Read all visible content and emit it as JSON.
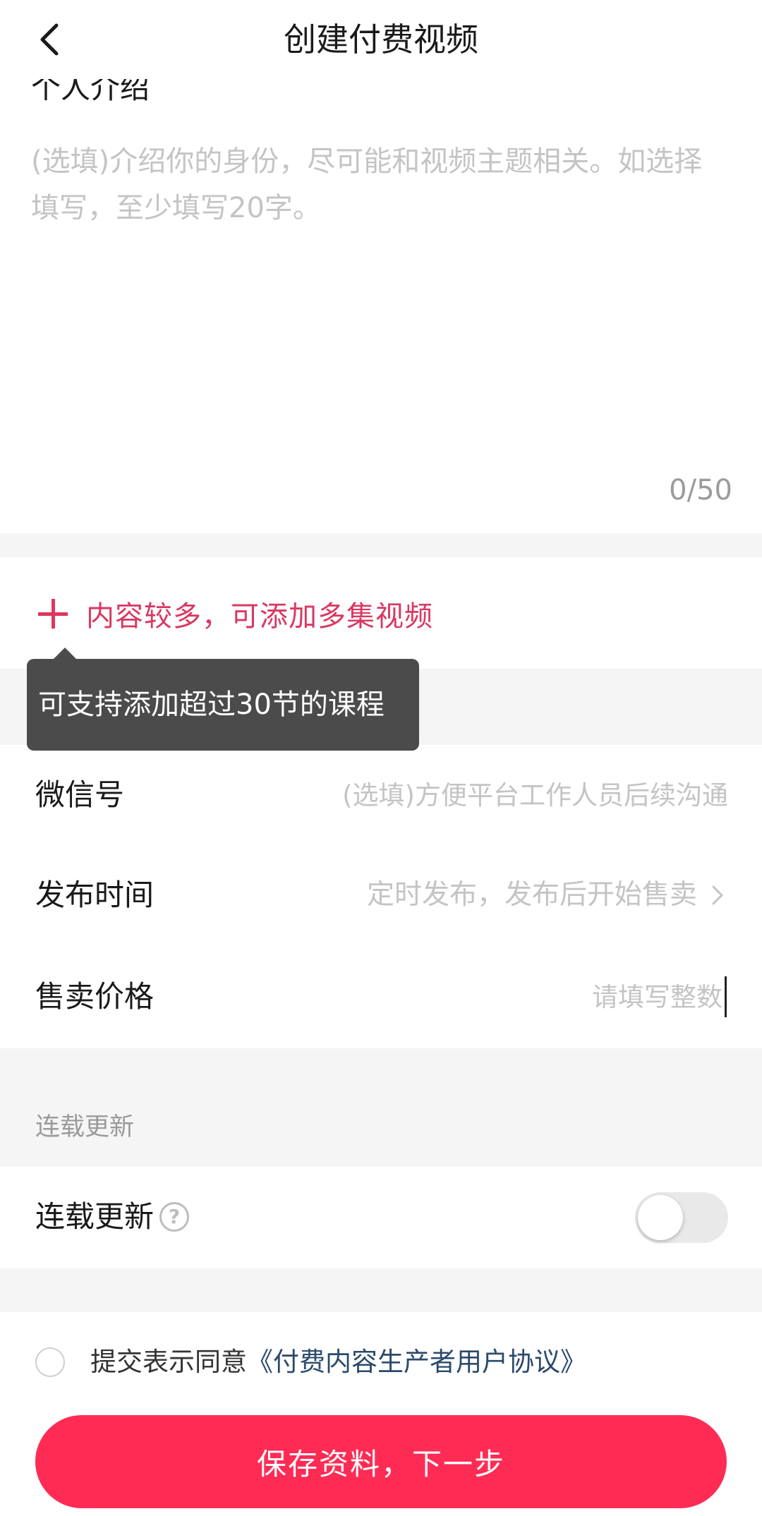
{
  "header": {
    "title": "创建付费视频",
    "back_icon": "chevron-left-icon"
  },
  "intro": {
    "label": "个人介绍",
    "placeholder": "(选填)介绍你的身份，尽可能和视频主题相关。如选择填写，至少填写20字。",
    "value": "",
    "char_count": "0/50"
  },
  "add_episodes": {
    "icon": "plus-icon",
    "label": "内容较多，可添加多集视频",
    "accent_color": "#d93862"
  },
  "tooltip": {
    "text": "可支持添加超过30节的课程"
  },
  "form": {
    "wechat": {
      "label": "微信号",
      "placeholder": "(选填)方便平台工作人员后续沟通",
      "value": ""
    },
    "publish_time": {
      "label": "发布时间",
      "value": "定时发布，发布后开始售卖",
      "icon": "chevron-right-icon"
    },
    "price": {
      "label": "售卖价格",
      "placeholder": "请填写整数",
      "value": ""
    }
  },
  "serial": {
    "section_title": "连载更新",
    "label": "连载更新",
    "help_icon": "question-circle-icon",
    "help_glyph": "?",
    "enabled": false
  },
  "agreement": {
    "checked": false,
    "prefix": "提交表示同意",
    "link": "《付费内容生产者用户协议》"
  },
  "submit": {
    "label": "保存资料，下一步",
    "color": "#fe2c55"
  }
}
